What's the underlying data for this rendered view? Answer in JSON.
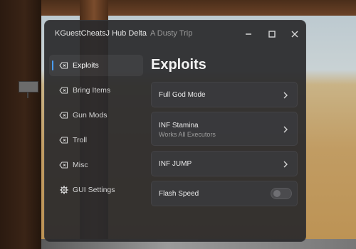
{
  "window": {
    "title": "KGuestCheatsJ Hub Delta",
    "subtitle": "A Dusty Trip",
    "controls": [
      "minimize-icon",
      "maximize-icon",
      "close-icon"
    ]
  },
  "sidebar": {
    "items": [
      {
        "label": "Exploits",
        "icon": "tag-icon",
        "active": true
      },
      {
        "label": "Bring Items",
        "icon": "tag-icon",
        "active": false
      },
      {
        "label": "Gun Mods",
        "icon": "tag-icon",
        "active": false
      },
      {
        "label": "Troll",
        "icon": "tag-icon",
        "active": false
      },
      {
        "label": "Misc",
        "icon": "tag-icon",
        "active": false
      },
      {
        "label": "GUI Settings",
        "icon": "gear-icon",
        "active": false
      }
    ]
  },
  "main": {
    "title": "Exploits",
    "rows": [
      {
        "label": "Full God Mode",
        "type": "button"
      },
      {
        "label": "INF Stamina",
        "description": "Works All Executors",
        "type": "button"
      },
      {
        "label": "INF JUMP",
        "type": "button"
      },
      {
        "label": "Flash Speed",
        "type": "toggle",
        "enabled": false
      }
    ]
  },
  "colors": {
    "accent": "#4a9eff",
    "window_bg": "#2a2a2c",
    "row_bg": "#3a3a3d"
  }
}
